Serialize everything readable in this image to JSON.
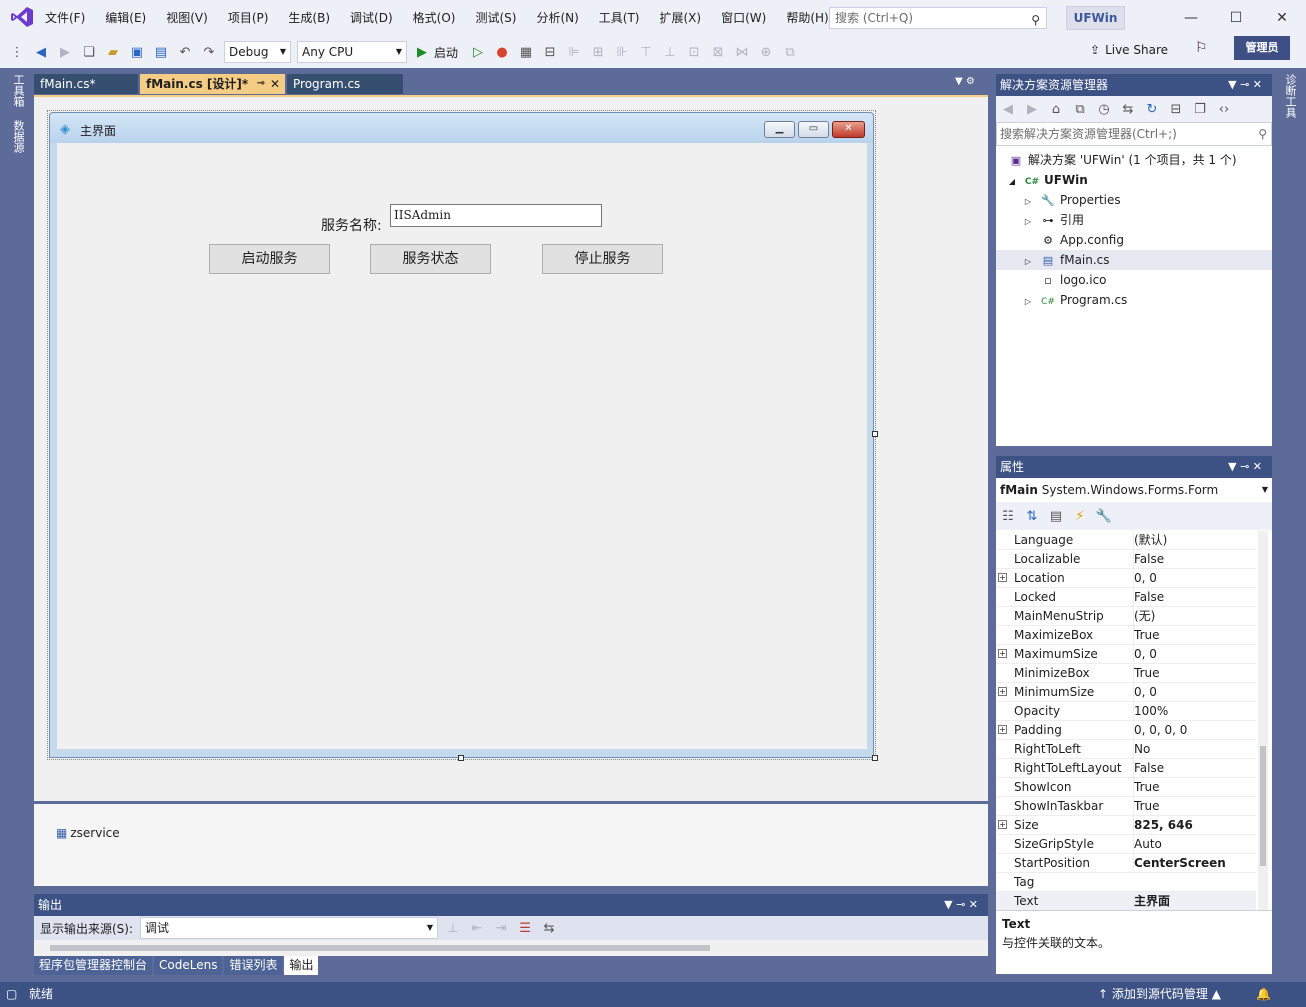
{
  "menubar": {
    "items": [
      "文件(F)",
      "编辑(E)",
      "视图(V)",
      "项目(P)",
      "生成(B)",
      "调试(D)",
      "格式(O)",
      "测试(S)",
      "分析(N)",
      "工具(T)",
      "扩展(X)",
      "窗口(W)",
      "帮助(H)"
    ],
    "search_placeholder": "搜索 (Ctrl+Q)",
    "app_name": "UFWin"
  },
  "toolbar": {
    "config": "Debug",
    "platform": "Any CPU",
    "start_label": "启动",
    "live_share": "Live Share",
    "admin": "管理员"
  },
  "side": {
    "left_top": "工具箱",
    "left_bottom": "数据源",
    "right": "诊断工具"
  },
  "doc_tabs": [
    {
      "label": "fMain.cs*"
    },
    {
      "label": "fMain.cs [设计]*"
    },
    {
      "label": "Program.cs"
    }
  ],
  "form": {
    "title": "主界面",
    "service_label": "服务名称:",
    "service_value": "IISAdmin",
    "buttons": {
      "start": "启动服务",
      "status": "服务状态",
      "stop": "停止服务"
    }
  },
  "tray": {
    "component": "zservice"
  },
  "output": {
    "title": "输出",
    "source_label": "显示输出来源(S):",
    "source_value": "调试",
    "tabs": [
      "程序包管理器控制台",
      "CodeLens",
      "错误列表",
      "输出"
    ]
  },
  "solution_explorer": {
    "title": "解决方案资源管理器",
    "search_placeholder": "搜索解决方案资源管理器(Ctrl+;)",
    "solution": "解决方案 'UFWin' (1 个项目，共 1 个)",
    "project": "UFWin",
    "items": [
      "Properties",
      "引用",
      "App.config",
      "fMain.cs",
      "logo.ico",
      "Program.cs"
    ]
  },
  "properties": {
    "title": "属性",
    "object_name": "fMain",
    "object_type": "System.Windows.Forms.Form",
    "rows": [
      {
        "name": "Language",
        "value": "(默认)"
      },
      {
        "name": "Localizable",
        "value": "False"
      },
      {
        "name": "Location",
        "value": "0, 0"
      },
      {
        "name": "Locked",
        "value": "False"
      },
      {
        "name": "MainMenuStrip",
        "value": "(无)"
      },
      {
        "name": "MaximizeBox",
        "value": "True"
      },
      {
        "name": "MaximumSize",
        "value": "0, 0"
      },
      {
        "name": "MinimizeBox",
        "value": "True"
      },
      {
        "name": "MinimumSize",
        "value": "0, 0"
      },
      {
        "name": "Opacity",
        "value": "100%"
      },
      {
        "name": "Padding",
        "value": "0, 0, 0, 0"
      },
      {
        "name": "RightToLeft",
        "value": "No"
      },
      {
        "name": "RightToLeftLayout",
        "value": "False"
      },
      {
        "name": "ShowIcon",
        "value": "True"
      },
      {
        "name": "ShowInTaskbar",
        "value": "True"
      },
      {
        "name": "Size",
        "value": "825, 646"
      },
      {
        "name": "SizeGripStyle",
        "value": "Auto"
      },
      {
        "name": "StartPosition",
        "value": "CenterScreen"
      },
      {
        "name": "Tag",
        "value": ""
      },
      {
        "name": "Text",
        "value": "主界面"
      }
    ],
    "desc_title": "Text",
    "desc_text": "与控件关联的文本。"
  },
  "status": {
    "ready": "就绪",
    "source_control": "添加到源代码管理"
  }
}
